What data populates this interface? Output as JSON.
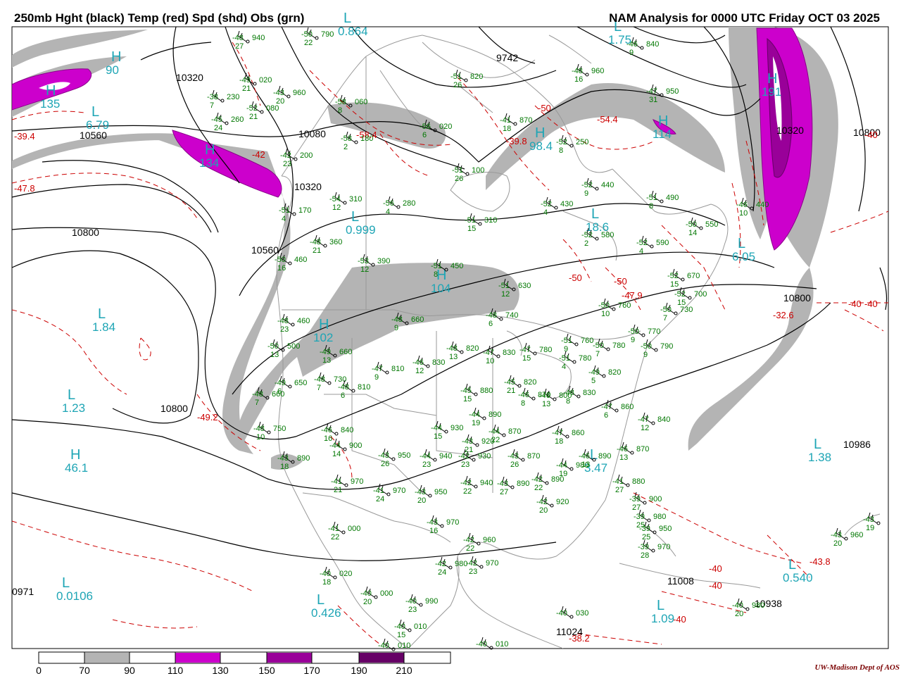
{
  "header": {
    "title_left": "250mb Hght (black) Temp (red) Spd (shd) Obs (grn)",
    "title_right": "NAM Analysis for 0000 UTC Friday  OCT 03 2025"
  },
  "colors": {
    "height_contour": "#000000",
    "temperature_contour": "#cc0000",
    "observation": "#007700",
    "pressure_center": "#1ea5b5",
    "speed_70": "#b4b4b4",
    "speed_110": "#cc00cc",
    "speed_150": "#990099",
    "speed_190": "#660066",
    "geography": "#999999"
  },
  "colorbar": {
    "labels": [
      "0",
      "70",
      "90",
      "110",
      "130",
      "150",
      "170",
      "190",
      "210"
    ]
  },
  "credit": "UW-Madison  Dept of AOS",
  "height_labels": [
    "10320",
    "10560",
    "10080",
    "10320",
    "10800",
    "10560",
    "10800",
    "9742",
    "10800",
    "10986",
    "11008",
    "10938",
    "11024",
    "10320",
    "10800",
    "0971"
  ],
  "temperature_labels": [
    "-39.4",
    "-47.8",
    "-42",
    "-58.4",
    "-39.8",
    "-54.4",
    "-50",
    "-50",
    "-50",
    "-47.9",
    "-32.6",
    "-40",
    "-40",
    "-49.2",
    "-43.8",
    "-40",
    "-40",
    "-38.2",
    "-40",
    "-40"
  ],
  "pressure_centers": [
    {
      "type": "H",
      "value": "135"
    },
    {
      "type": "L",
      "value": "6.79"
    },
    {
      "type": "H",
      "value": "134"
    },
    {
      "type": "L",
      "value": "0.999"
    },
    {
      "type": "H",
      "value": "104"
    },
    {
      "type": "H",
      "value": "98.4"
    },
    {
      "type": "L",
      "value": "18.6"
    },
    {
      "type": "L",
      "value": "1.75"
    },
    {
      "type": "H",
      "value": "191"
    },
    {
      "type": "L",
      "value": "6.05"
    },
    {
      "type": "L",
      "value": "1.84"
    },
    {
      "type": "H",
      "value": "102"
    },
    {
      "type": "L",
      "value": "1.23"
    },
    {
      "type": "H",
      "value": "46.1"
    },
    {
      "type": "L",
      "value": "1.38"
    },
    {
      "type": "L",
      "value": "3.47"
    },
    {
      "type": "L",
      "value": "0.0106"
    },
    {
      "type": "L",
      "value": "0.426"
    },
    {
      "type": "L",
      "value": "1.09"
    },
    {
      "type": "L",
      "value": "0.540"
    },
    {
      "type": "H",
      "value": "114"
    },
    {
      "type": "H",
      "value": "90"
    },
    {
      "type": "L",
      "value": "0.864"
    }
  ],
  "observations": [
    {
      "temp": "-48",
      "hgt": "940",
      "spd": "27"
    },
    {
      "temp": "-50",
      "hgt": "790",
      "spd": "22"
    },
    {
      "temp": "-49",
      "hgt": "020",
      "spd": "21"
    },
    {
      "temp": "-43",
      "hgt": "960",
      "spd": "20"
    },
    {
      "temp": "-38",
      "hgt": "230",
      "spd": "7"
    },
    {
      "temp": "-52",
      "hgt": "080",
      "spd": "21"
    },
    {
      "temp": "-45",
      "hgt": "260",
      "spd": "24"
    },
    {
      "temp": "-42",
      "hgt": "200",
      "spd": "23"
    },
    {
      "temp": "-58",
      "hgt": "180",
      "spd": "2"
    },
    {
      "temp": "-58",
      "hgt": "060",
      "spd": "8"
    },
    {
      "temp": "-56",
      "hgt": "020",
      "spd": "6"
    },
    {
      "temp": "-51",
      "hgt": "820",
      "spd": "26"
    },
    {
      "temp": "-41",
      "hgt": "870",
      "spd": "18"
    },
    {
      "temp": "-52",
      "hgt": "250",
      "spd": "8"
    },
    {
      "temp": "-48",
      "hgt": "960",
      "spd": "16"
    },
    {
      "temp": "-47",
      "hgt": "950",
      "spd": "31"
    },
    {
      "temp": "-46",
      "hgt": "840",
      "spd": "9"
    },
    {
      "temp": "-51",
      "hgt": "170",
      "spd": "4"
    },
    {
      "temp": "-54",
      "hgt": "310",
      "spd": "12"
    },
    {
      "temp": "-56",
      "hgt": "280",
      "spd": "4"
    },
    {
      "temp": "-51",
      "hgt": "100",
      "spd": "26"
    },
    {
      "temp": "-52",
      "hgt": "440",
      "spd": "9"
    },
    {
      "temp": "-52",
      "hgt": "430",
      "spd": "4"
    },
    {
      "temp": "-51",
      "hgt": "490",
      "spd": "8"
    },
    {
      "temp": "-48",
      "hgt": "360",
      "spd": "21"
    },
    {
      "temp": "-51",
      "hgt": "310",
      "spd": "15"
    },
    {
      "temp": "-52",
      "hgt": "580",
      "spd": "2"
    },
    {
      "temp": "-52",
      "hgt": "590",
      "spd": "4"
    },
    {
      "temp": "-50",
      "hgt": "550",
      "spd": "14"
    },
    {
      "temp": "-46",
      "hgt": "440",
      "spd": "10"
    },
    {
      "temp": "-50",
      "hgt": "460",
      "spd": "16"
    },
    {
      "temp": "-53",
      "hgt": "390",
      "spd": "12"
    },
    {
      "temp": "-51",
      "hgt": "450",
      "spd": "8"
    },
    {
      "temp": "-51",
      "hgt": "630",
      "spd": "12"
    },
    {
      "temp": "-52",
      "hgt": "670",
      "spd": "15"
    },
    {
      "temp": "-52",
      "hgt": "700",
      "spd": "15"
    },
    {
      "temp": "-50",
      "hgt": "760",
      "spd": "10"
    },
    {
      "temp": "-50",
      "hgt": "730",
      "spd": "7"
    },
    {
      "temp": "-48",
      "hgt": "460",
      "spd": "23"
    },
    {
      "temp": "-48",
      "hgt": "740",
      "spd": "6"
    },
    {
      "temp": "-48",
      "hgt": "660",
      "spd": "9"
    },
    {
      "temp": "-50",
      "hgt": "500",
      "spd": "13"
    },
    {
      "temp": "-49",
      "hgt": "660",
      "spd": "13"
    },
    {
      "temp": "-48",
      "hgt": "820",
      "spd": "13"
    },
    {
      "temp": "-47",
      "hgt": "830",
      "spd": "10"
    },
    {
      "temp": "-47",
      "hgt": "780",
      "spd": "15"
    },
    {
      "temp": "-51",
      "hgt": "760",
      "spd": "9"
    },
    {
      "temp": "-50",
      "hgt": "780",
      "spd": "7"
    },
    {
      "temp": "-50",
      "hgt": "770",
      "spd": "9"
    },
    {
      "temp": "-50",
      "hgt": "790",
      "spd": "9"
    },
    {
      "temp": "-49",
      "hgt": "650",
      "spd": "6"
    },
    {
      "temp": "-48",
      "hgt": "730",
      "spd": "7"
    },
    {
      "temp": "-47",
      "hgt": "810",
      "spd": "9"
    },
    {
      "temp": "-46",
      "hgt": "830",
      "spd": "12"
    },
    {
      "temp": "-51",
      "hgt": "780",
      "spd": "4"
    },
    {
      "temp": "-49",
      "hgt": "820",
      "spd": "5"
    },
    {
      "temp": "-48",
      "hgt": "660",
      "spd": "7"
    },
    {
      "temp": "-48",
      "hgt": "810",
      "spd": "6"
    },
    {
      "temp": "-45",
      "hgt": "880",
      "spd": "15"
    },
    {
      "temp": "-45",
      "hgt": "820",
      "spd": "21"
    },
    {
      "temp": "-48",
      "hgt": "830",
      "spd": "8"
    },
    {
      "temp": "-47",
      "hgt": "860",
      "spd": "6"
    },
    {
      "temp": "-46",
      "hgt": "870",
      "spd": "8"
    },
    {
      "temp": "-48",
      "hgt": "750",
      "spd": "10"
    },
    {
      "temp": "-46",
      "hgt": "840",
      "spd": "16"
    },
    {
      "temp": "-44",
      "hgt": "890",
      "spd": "19"
    },
    {
      "temp": "-46",
      "hgt": "800",
      "spd": "13"
    },
    {
      "temp": "-44",
      "hgt": "930",
      "spd": "15"
    },
    {
      "temp": "-44",
      "hgt": "870",
      "spd": "22"
    },
    {
      "temp": "-43",
      "hgt": "920",
      "spd": "21"
    },
    {
      "temp": "-47",
      "hgt": "860",
      "spd": "18"
    },
    {
      "temp": "-47",
      "hgt": "840",
      "spd": "12"
    },
    {
      "temp": "-44",
      "hgt": "900",
      "spd": "14"
    },
    {
      "temp": "-43",
      "hgt": "950",
      "spd": "26"
    },
    {
      "temp": "-44",
      "hgt": "940",
      "spd": "23"
    },
    {
      "temp": "-42",
      "hgt": "930",
      "spd": "23"
    },
    {
      "temp": "-43",
      "hgt": "870",
      "spd": "26"
    },
    {
      "temp": "-44",
      "hgt": "980",
      "spd": "19"
    },
    {
      "temp": "-46",
      "hgt": "890",
      "spd": "13"
    },
    {
      "temp": "-46",
      "hgt": "870",
      "spd": "13"
    },
    {
      "temp": "-43",
      "hgt": "890",
      "spd": "18"
    },
    {
      "temp": "-41",
      "hgt": "970",
      "spd": "21"
    },
    {
      "temp": "-41",
      "hgt": "970",
      "spd": "24"
    },
    {
      "temp": "-43",
      "hgt": "950",
      "spd": "20"
    },
    {
      "temp": "-42",
      "hgt": "940",
      "spd": "22"
    },
    {
      "temp": "-43",
      "hgt": "890",
      "spd": "27"
    },
    {
      "temp": "-42",
      "hgt": "890",
      "spd": "22"
    },
    {
      "temp": "-41",
      "hgt": "880",
      "spd": "27"
    },
    {
      "temp": "-42",
      "hgt": "920",
      "spd": "20"
    },
    {
      "temp": "-39",
      "hgt": "900",
      "spd": "27"
    },
    {
      "temp": "-41",
      "hgt": "000",
      "spd": "22"
    },
    {
      "temp": "-43",
      "hgt": "970",
      "spd": "16"
    },
    {
      "temp": "-42",
      "hgt": "960",
      "spd": "22"
    },
    {
      "temp": "-42",
      "hgt": "980",
      "spd": "24"
    },
    {
      "temp": "-42",
      "hgt": "970",
      "spd": "23"
    },
    {
      "temp": "-40",
      "hgt": "020",
      "spd": "18"
    },
    {
      "temp": "-40",
      "hgt": "000",
      "spd": "20"
    },
    {
      "temp": "-40",
      "hgt": "990",
      "spd": "23"
    },
    {
      "temp": "-40",
      "hgt": "010",
      "spd": "15"
    },
    {
      "temp": "-40",
      "hgt": "010",
      "spd": ""
    },
    {
      "temp": "-40",
      "hgt": "010",
      "spd": ""
    },
    {
      "temp": "-40",
      "hgt": "030",
      "spd": ""
    },
    {
      "temp": "-39",
      "hgt": "950",
      "spd": "25"
    },
    {
      "temp": "-39",
      "hgt": "970",
      "spd": "28"
    },
    {
      "temp": "-39",
      "hgt": "980",
      "spd": "25"
    },
    {
      "temp": "-40",
      "hgt": "980",
      "spd": "20"
    },
    {
      "temp": "-43",
      "hgt": "960",
      "spd": "20"
    },
    {
      "temp": "-43",
      "hgt": "",
      "spd": "19"
    }
  ]
}
